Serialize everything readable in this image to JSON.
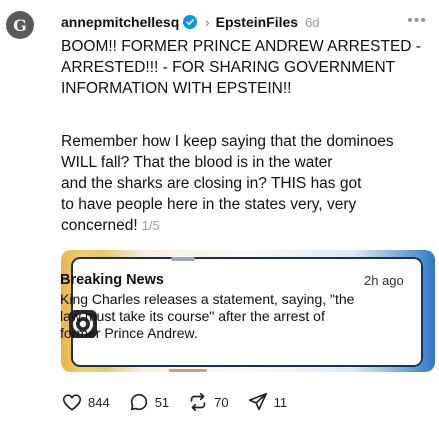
{
  "post": {
    "username": "annepmitchellesq",
    "community": "EpsteinFiles",
    "time": "6d",
    "headline": "BOOM!! FORMER PRINCE ANDREW ARRESTED - ARRESTED!!! - FOR SHARING GOVERNMENT INFORMATION WITH EPSTEIN!!",
    "body_lines": [
      "Remember how I keep saying that the dominoes",
      "WILL fall? That the blood is in the water",
      "and the sharks are closing in? THIS has got",
      "to have people here in the states very, very",
      "concerned!"
    ],
    "page_count": "1/5"
  },
  "image": {
    "news_title": "Breaking News",
    "news_time": "2h ago",
    "news_body": "King Charles releases a statement, saying, \"the law must take its course\" after the arrest of former Prince Andrew."
  },
  "actions": {
    "likes": "844",
    "replies": "51",
    "reposts": "70",
    "shares": "11"
  },
  "colors": {
    "verified": "#0095f6",
    "news_frame": "#1e2f52"
  },
  "icons": {
    "verified": "verified-badge-icon",
    "chevron": "chevron-right-icon",
    "more": "more-horizontal-icon",
    "news_app": "news-app-icon",
    "like": "heart-icon",
    "reply": "comment-icon",
    "repost": "repost-icon",
    "share": "share-icon"
  }
}
